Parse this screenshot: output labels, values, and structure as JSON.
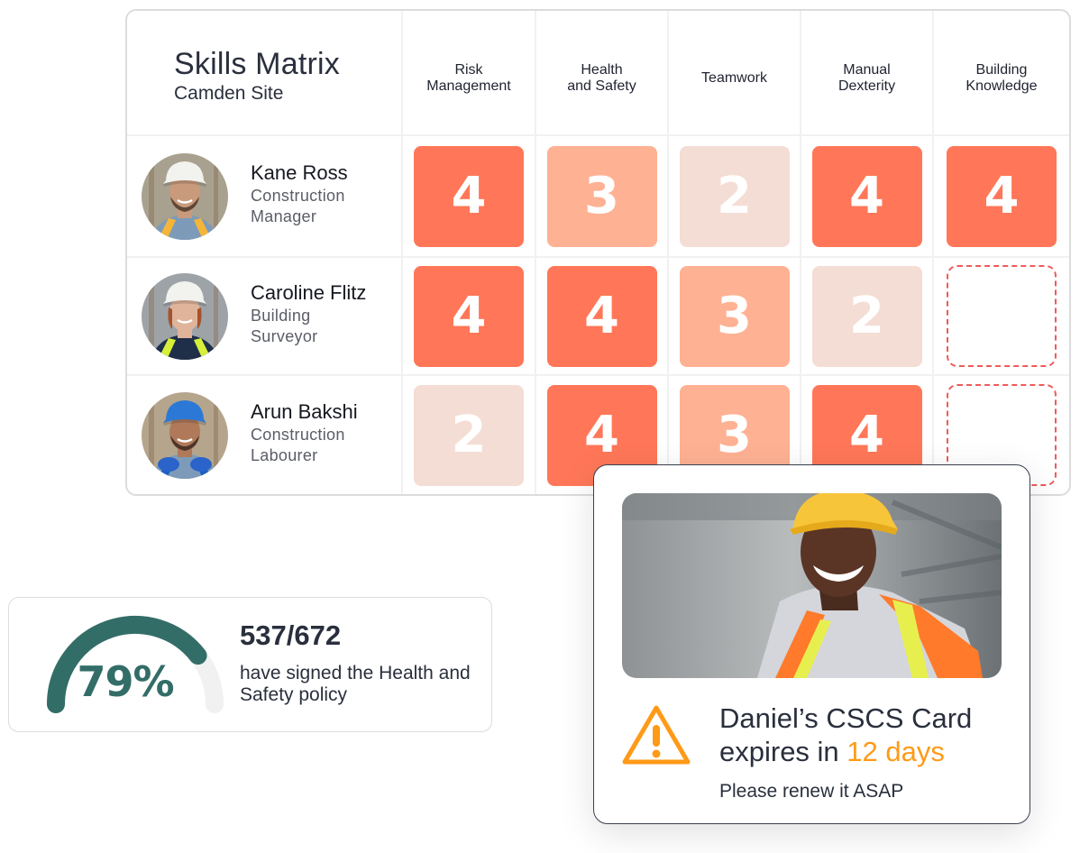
{
  "matrix": {
    "title": "Skills Matrix",
    "subtitle": "Camden Site",
    "columns": [
      {
        "line1": "Risk",
        "line2": "Management"
      },
      {
        "line1": "Health",
        "line2": "and Safety"
      },
      {
        "line1": "Teamwork",
        "line2": ""
      },
      {
        "line1": "Manual",
        "line2": "Dexterity"
      },
      {
        "line1": "Building",
        "line2": "Knowledge"
      }
    ],
    "rows": [
      {
        "name": "Kane Ross",
        "role_line1": "Construction",
        "role_line2": "Manager",
        "avatar": "worker-white-helmet-man",
        "scores": [
          4,
          3,
          2,
          4,
          4
        ]
      },
      {
        "name": "Caroline Flitz",
        "role_line1": "Building",
        "role_line2": "Surveyor",
        "avatar": "worker-white-helmet-woman",
        "scores": [
          4,
          4,
          3,
          2,
          null
        ]
      },
      {
        "name": "Arun Bakshi",
        "role_line1": "Construction",
        "role_line2": "Labourer",
        "avatar": "worker-blue-helmet-man",
        "scores": [
          2,
          4,
          3,
          4,
          null
        ]
      }
    ],
    "score_colors": {
      "4": "#FF7758",
      "3": "#FFB193",
      "2": "#F4DDD4"
    },
    "missing_color": "#EF5A5A"
  },
  "policy": {
    "percent_label": "79%",
    "percent_value": 0.79,
    "count": "537/672",
    "description": "have signed the Health and Safety policy",
    "accent": "#336D67",
    "track": "#F1F1F1"
  },
  "alert": {
    "photo": "smiling-worker-yellow-helmet",
    "icon": "warning-triangle-icon",
    "title_prefix": "Daniel’s CSCS Card",
    "title_mid": "expires in ",
    "title_highlight": "12 days",
    "subtitle": "Please renew it ASAP",
    "highlight_color": "#FF9A17"
  }
}
